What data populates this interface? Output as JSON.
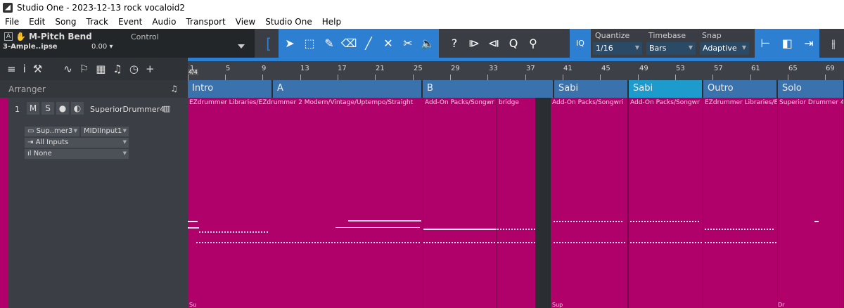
{
  "window": {
    "title": "Studio One - 2023-12-13 rock vocaloid2"
  },
  "menu": [
    "File",
    "Edit",
    "Song",
    "Track",
    "Event",
    "Audio",
    "Transport",
    "View",
    "Studio One",
    "Help"
  ],
  "inspector_bar": {
    "param": "M-Pitch Bend",
    "control": "Control",
    "device": "3-Ample..ipse",
    "value": "0.00"
  },
  "tools": [
    "bracket-icon",
    "arrow-icon",
    "range-icon",
    "pencil-icon",
    "eraser-icon",
    "paint-icon",
    "mute-icon",
    "split-icon",
    "listen-icon"
  ],
  "tools2": [
    "help-icon",
    "nudge-left-icon",
    "nudge-right-icon",
    "zoom-icon",
    "bend-icon"
  ],
  "iq_label": "IQ",
  "quantize": {
    "label": "Quantize",
    "value": "1/16"
  },
  "timebase": {
    "label": "Timebase",
    "value": "Bars"
  },
  "snap": {
    "label": "Snap",
    "value": "Adaptive"
  },
  "arranger": {
    "label": "Arranger"
  },
  "track": {
    "number": "1",
    "mute": "M",
    "solo": "S",
    "name": "SuperiorDrummer4",
    "instrument": "Sup..mer3",
    "midi_input": "MIDIInput1",
    "inputs": "All Inputs",
    "output": "None",
    "color": "#b0006a"
  },
  "ruler": {
    "signature": "4/4",
    "bars": [
      "1",
      "5",
      "9",
      "13",
      "17",
      "21",
      "25",
      "29",
      "33",
      "37",
      "41",
      "45",
      "49",
      "53",
      "57",
      "61",
      "65",
      "69"
    ]
  },
  "markers": [
    {
      "label": "Intro"
    },
    {
      "label": "A"
    },
    {
      "label": "B"
    },
    {
      "label": "Sabi"
    },
    {
      "label": "Sabi"
    },
    {
      "label": "Outro"
    },
    {
      "label": "Solo"
    }
  ],
  "clips": [
    {
      "name": "EZdrummer Libraries/EZdrummer 2 Modern/Vintage/Uptempo/Straight"
    },
    {
      "name": "Add-On Packs/Songwr"
    },
    {
      "name": "bridge"
    },
    {
      "name": "Add-On Packs/Songwri"
    },
    {
      "name": "Add-On Packs/Songwr"
    },
    {
      "name": "EZdrummer Libraries/E"
    },
    {
      "name": "Superior Drummer 4"
    }
  ],
  "clip_footer": {
    "a": "Su",
    "b": "Sup",
    "c": "Dr Dr"
  }
}
